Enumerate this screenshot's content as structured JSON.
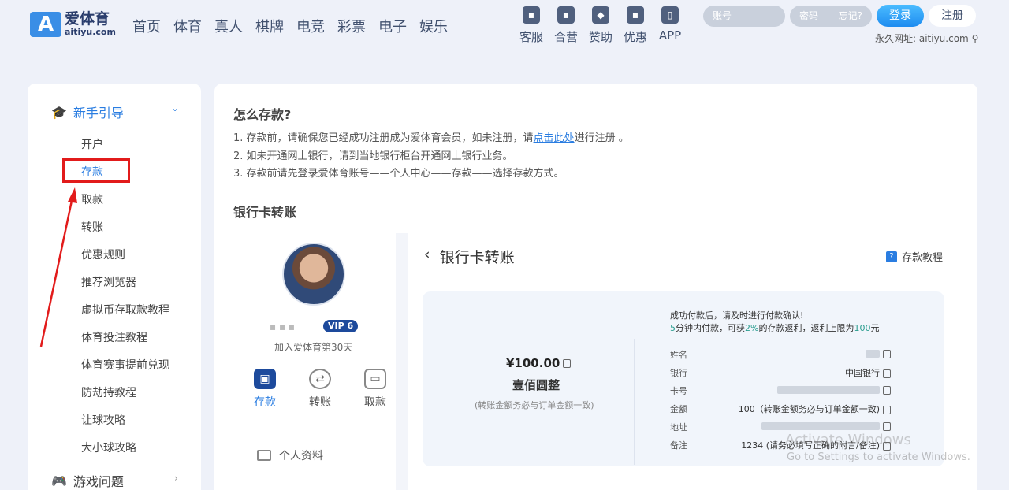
{
  "header": {
    "logo_mark": "A",
    "logo_cn": "爱体育",
    "logo_en": "aitiyu.com",
    "nav": [
      "首页",
      "体育",
      "真人",
      "棋牌",
      "电竞",
      "彩票",
      "电子",
      "娱乐"
    ],
    "tools": [
      "客服",
      "合营",
      "赞助",
      "优惠",
      "APP"
    ],
    "account_placeholder": "账号",
    "password_placeholder": "密码",
    "forgot": "忘记?",
    "login": "登录",
    "register": "注册",
    "permanent_url": "永久网址: aitiyu.com"
  },
  "sidebar": {
    "section": "新手引导",
    "items": [
      "开户",
      "存款",
      "取款",
      "转账",
      "优惠规则",
      "推荐浏览器",
      "虚拟币存取款教程",
      "体育投注教程",
      "体育赛事提前兑现",
      "防劫持教程",
      "让球攻略",
      "大小球攻略"
    ],
    "active_index": 1,
    "footer_section": "游戏问题"
  },
  "main": {
    "title": "怎么存款?",
    "steps": [
      {
        "prefix": "1. 存款前，请确保您已经成功注册成为爱体育会员，如未注册，请",
        "link": "点击此处",
        "suffix": "进行注册 。"
      },
      {
        "text": "2. 如未开通网上银行，请到当地银行柜台开通网上银行业务。"
      },
      {
        "text": "3. 存款前请先登录爱体育账号——个人中心——存款——选择存款方式。"
      }
    ],
    "subtitle": "银行卡转账"
  },
  "profile": {
    "vip": "VIP 6",
    "join": "加入爱体育第30天",
    "actions": [
      "存款",
      "转账",
      "取款"
    ],
    "personal": "个人资料"
  },
  "panel": {
    "back_title": "银行卡转账",
    "tutorial": "存款教程",
    "amount": "¥100.00",
    "amount_cn": "壹佰圆整",
    "amount_note": "(转账金额务必与订单金额一致)",
    "notice1": "成功付款后，请及时进行付款确认!",
    "notice2_parts": [
      "5",
      "分钟内付款，可获",
      "2%",
      "的存款返利，返利上限为",
      "100",
      "元"
    ],
    "details": [
      {
        "label": "姓名",
        "value": ""
      },
      {
        "label": "银行",
        "value": "中国银行"
      },
      {
        "label": "卡号",
        "value": ""
      },
      {
        "label": "金额",
        "value": "100（转账金额务必与订单金额一致)"
      },
      {
        "label": "地址",
        "value": ""
      },
      {
        "label": "备注",
        "value": "1234 (请务必填写正确的附言/备注)"
      }
    ]
  },
  "watermark": {
    "line1": "Activate Windows",
    "line2": "Go to Settings to activate Windows."
  },
  "colors": {
    "accent": "#2a7de1",
    "highlight": "#e21b1b",
    "background": "#eef1f9"
  }
}
